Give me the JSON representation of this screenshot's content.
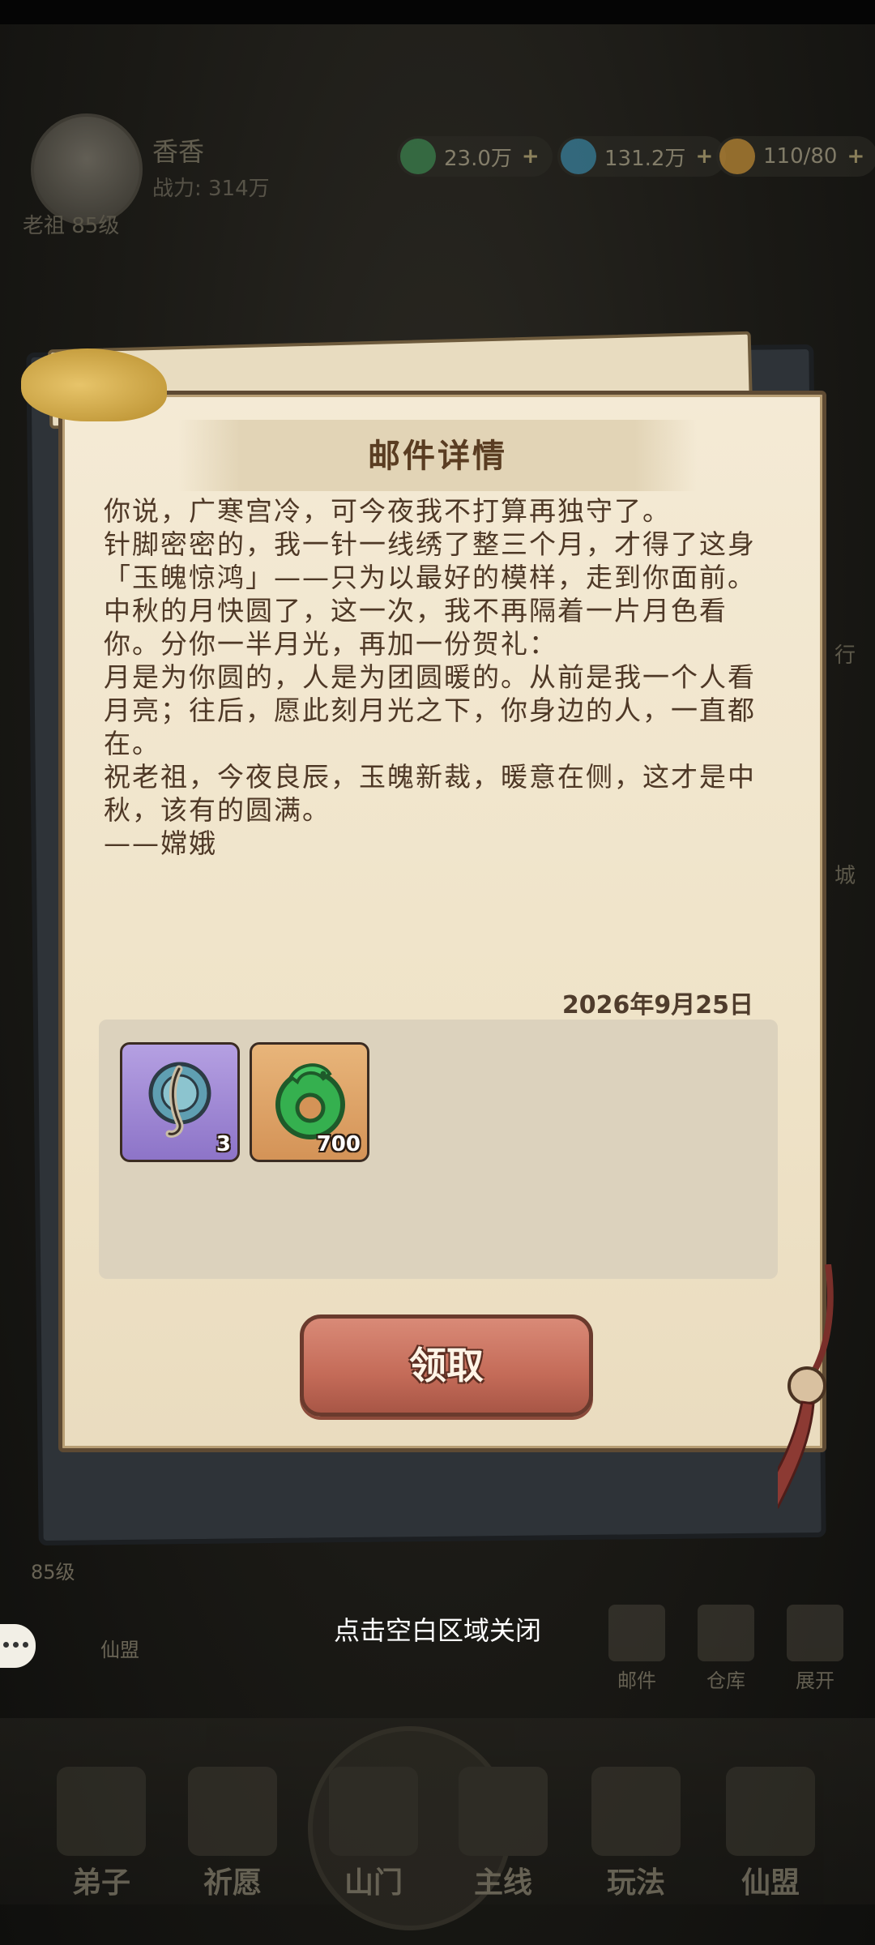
{
  "background": {
    "player": {
      "name": "香香",
      "power": "战力: 314万",
      "title_level": "老祖 85级"
    },
    "resources": [
      {
        "value": "23.0万",
        "icon": "spirit-stone-icon",
        "color": "#3f8f55"
      },
      {
        "value": "131.2万",
        "icon": "jade-icon",
        "color": "#3d8fb0"
      },
      {
        "value": "110/80",
        "icon": "peach-icon",
        "color": "#d49a3a"
      }
    ],
    "side_labels": {
      "right_1": "行",
      "right_2": "城"
    },
    "level_tag": "85级",
    "guild_tag": "仙盟",
    "tools": [
      {
        "label": "邮件",
        "icon": "mail-icon"
      },
      {
        "label": "仓库",
        "icon": "warehouse-icon"
      },
      {
        "label": "展开",
        "icon": "expand-icon"
      }
    ],
    "bottom_nav": [
      {
        "label": "弟子",
        "icon": "disciple-icon"
      },
      {
        "label": "祈愿",
        "icon": "wish-icon"
      },
      {
        "label": "山门",
        "icon": "gate-icon"
      },
      {
        "label": "主线",
        "icon": "mainline-icon"
      },
      {
        "label": "玩法",
        "icon": "gameplay-icon"
      },
      {
        "label": "仙盟",
        "icon": "alliance-icon"
      }
    ]
  },
  "dialog": {
    "title": "邮件详情",
    "letter_lines": [
      "你说，广寒宫冷，可今夜我不打算再独守了。",
      "针脚密密的，我一针一线绣了整三个月，才得了这身「玉魄惊鸿」——只为以最好的模样，走到你面前。",
      "中秋的月快圆了，这一次，我不再隔着一片月色看你。分你一半月光，再加一份贺礼：",
      "月是为你圆的，人是为团圆暖的。从前是我一个人看月亮；往后，愿此刻月光之下，你身边的人，一直都在。",
      "祝老祖，今夜良辰，玉魄新裁，暖意在侧，这才是中秋，该有的圆满。",
      "——嫦娥"
    ],
    "date": "2026年9月25日",
    "rewards": [
      {
        "icon": "orb-talisman-icon",
        "count": "3",
        "rarity_color": "#a78ed6"
      },
      {
        "icon": "jade-dragon-icon",
        "count": "700",
        "rarity_color": "#e0a468"
      }
    ],
    "claim_label": "领取"
  },
  "close_hint": "点击空白区域关闭"
}
